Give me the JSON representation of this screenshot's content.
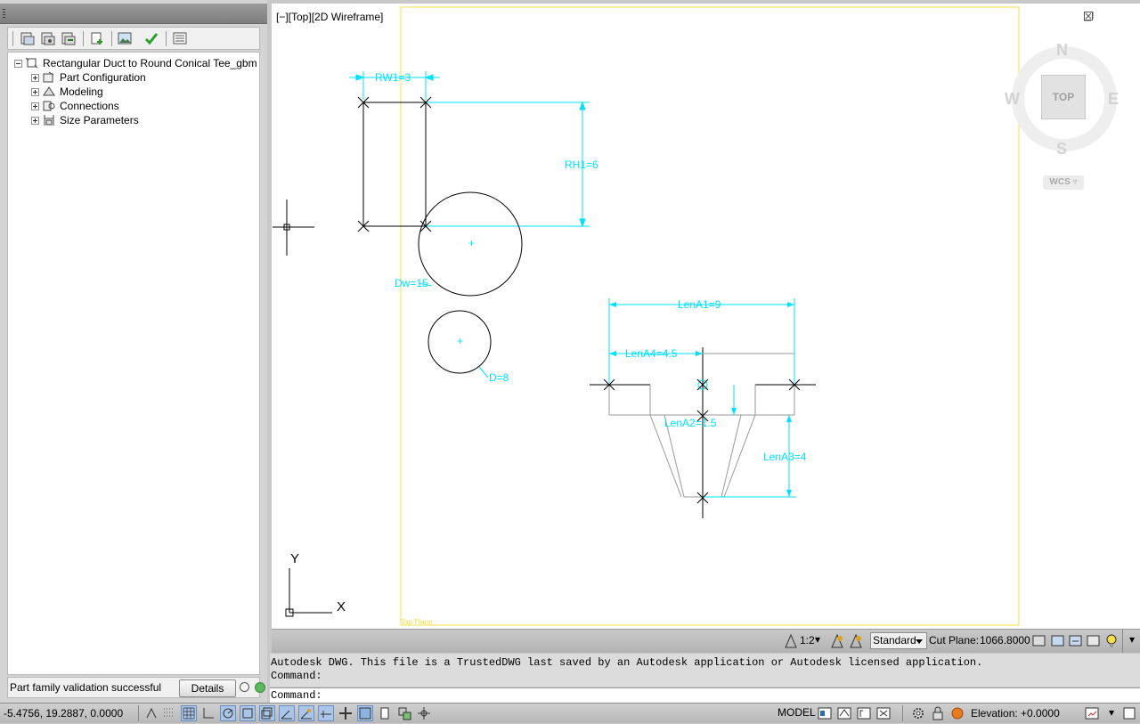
{
  "left_panel": {
    "toolbar_icons": [
      "save-icon",
      "save-as-icon",
      "save-copy-icon",
      "new-part-icon",
      "image-icon",
      "validate-check-icon",
      "properties-icon"
    ],
    "tree": {
      "root": "Rectangular Duct to Round Conical Tee_gbm",
      "children": [
        "Part Configuration",
        "Modeling",
        "Connections",
        "Size Parameters"
      ]
    },
    "status_text": "Part family validation successful",
    "details_label": "Details"
  },
  "viewport": {
    "label": "[−][Top][2D Wireframe]",
    "plane_label": "Top Plane",
    "dimensions": {
      "rw1": "RW1=3",
      "rh1": "RH1=6",
      "lena1": "LenA1=9",
      "lena4": "LenA4=4.5",
      "lena2": "LenA2=1.5",
      "lena3": "LenA3=4",
      "dia_large": "Dw=15",
      "dia_small": "D=8"
    },
    "viewcube": {
      "north": "N",
      "south": "S",
      "east": "E",
      "west": "W",
      "face": "TOP",
      "wcs": "WCS"
    },
    "ucs": {
      "x": "X",
      "y": "Y"
    }
  },
  "viewport_status": {
    "scale": "1:2",
    "style": "Standard",
    "cut_plane_label": "Cut Plane:",
    "cut_plane_value": "1066.8000"
  },
  "command": {
    "history_line1": "Autodesk DWG.  This file is a TrustedDWG last saved by an Autodesk application or Autodesk licensed application.",
    "history_line2": "Command:",
    "prompt": "Command:"
  },
  "app_status": {
    "coords": "-5.4756,  19.2887, 0.0000",
    "model": "MODEL",
    "elevation": "Elevation: +0.0000"
  },
  "colors": {
    "dimension": "#00e1ff",
    "boundary": "#f5e04a",
    "geometry": "#000000"
  }
}
